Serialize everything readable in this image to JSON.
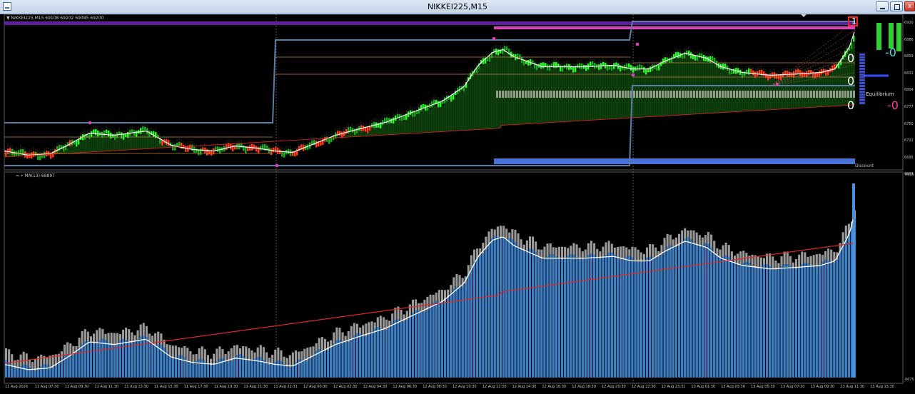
{
  "window": {
    "title": "NIKKEI225,M15",
    "buttons": {
      "minimize": "",
      "maximize": "",
      "close": "x"
    }
  },
  "main_chart": {
    "symbol_label": "▼ NIKKEI225,M15  69108 69202 69085 69200",
    "zones": {
      "equilibrium_label": "Equilibrium",
      "discount_label": "Discount"
    },
    "overlay_text": {
      "zero_a": "0",
      "zero_b": "0",
      "zero_c": "0",
      "neg_cyan": "-0",
      "neg_magenta": "-0",
      "box_value": "1"
    },
    "price_axis": [
      "6920",
      "6886",
      "6859",
      "6831",
      "6804",
      "6777",
      "6750",
      "6722",
      "6695",
      "6668"
    ]
  },
  "indicator": {
    "label": "= • MA(13) 68897",
    "axis": [
      "6915",
      "6675"
    ]
  },
  "time_axis": [
    "11 Aug 2026",
    "11 Aug 07:30",
    "11 Aug 09:30",
    "11 Aug 11:30",
    "11 Aug 13:30",
    "11 Aug 15:30",
    "11 Aug 17:30",
    "11 Aug 19:30",
    "11 Aug 21:30",
    "11 Aug 22:31",
    "12 Aug 00:30",
    "12 Aug 02:30",
    "12 Aug 04:30",
    "12 Aug 06:30",
    "12 Aug 08:30",
    "12 Aug 10:30",
    "12 Aug 12:30",
    "12 Aug 14:30",
    "12 Aug 16:30",
    "12 Aug 18:30",
    "12 Aug 20:30",
    "12 Aug 22:30",
    "12 Aug 23:31",
    "13 Aug 01:30",
    "13 Aug 03:30",
    "13 Aug 05:30",
    "13 Aug 07:30",
    "13 Aug 09:30",
    "13 Aug 11:30",
    "13 Aug 13:30"
  ],
  "colors": {
    "bull_strong": "#22ff22",
    "bull_mid": "#1ca81c",
    "bull_dark": "#0f5f0f",
    "bear": "#ff3b1a",
    "ma_red": "#d02020",
    "ma_white": "#ffffff",
    "zone_line": "#5b7ea8",
    "premium_band": "#5c1f9e",
    "magenta": "#e040c0",
    "hist_blue": "#3a7fc8",
    "hist_gray": "#9a9a9a",
    "discount_band": "#4a73d8"
  }
}
